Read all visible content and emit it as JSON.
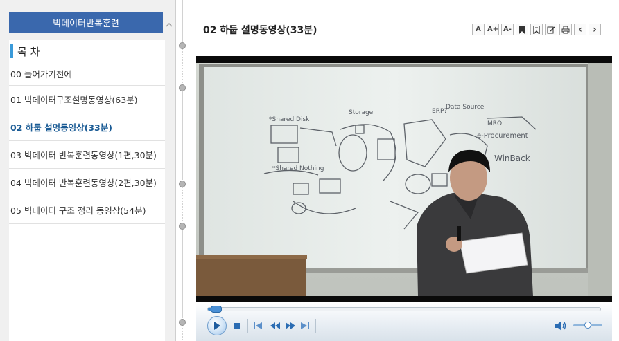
{
  "sidebar": {
    "course_title": "빅데이터반복훈련",
    "toc_heading": "목 차",
    "items": [
      {
        "label": "00 들어가기전에",
        "active": false
      },
      {
        "label": "01 빅데이터구조설명동영상(63분)",
        "active": false
      },
      {
        "label": "02 하둡 설명동영상(33분)",
        "active": true
      },
      {
        "label": "03 빅데이터 반복훈련동영상(1편,30분)",
        "active": false
      },
      {
        "label": "04 빅데이터 반복훈련동영상(2편,30분)",
        "active": false
      },
      {
        "label": "05 빅데이터 구조 정리 동영상(54분)",
        "active": false
      }
    ]
  },
  "main": {
    "lesson_title": "02 하둡 설명동영상(33분)",
    "toolbar": [
      {
        "name": "font-size-reset-icon",
        "glyph": "A"
      },
      {
        "name": "font-increase-icon",
        "glyph": "A+"
      },
      {
        "name": "font-decrease-icon",
        "glyph": "A-"
      },
      {
        "name": "bookmark-icon"
      },
      {
        "name": "bookmark-list-icon"
      },
      {
        "name": "note-icon"
      },
      {
        "name": "print-icon"
      },
      {
        "name": "previous-icon",
        "glyph": "‹"
      },
      {
        "name": "next-icon",
        "glyph": "›"
      }
    ],
    "video": {
      "board_text": [
        "*Shared Disk",
        "*Shared Nothing",
        "e-Procurement",
        "WinBack",
        "ERP?",
        "MRO",
        "Storage",
        "Data Source"
      ]
    },
    "player": {
      "progress": 0.02,
      "volume": 0.5
    }
  },
  "colors": {
    "brand": "#3a68ad",
    "accent": "#3a9ad9",
    "active_item": "#1a5b95",
    "player_blue": "#3f88cf"
  }
}
